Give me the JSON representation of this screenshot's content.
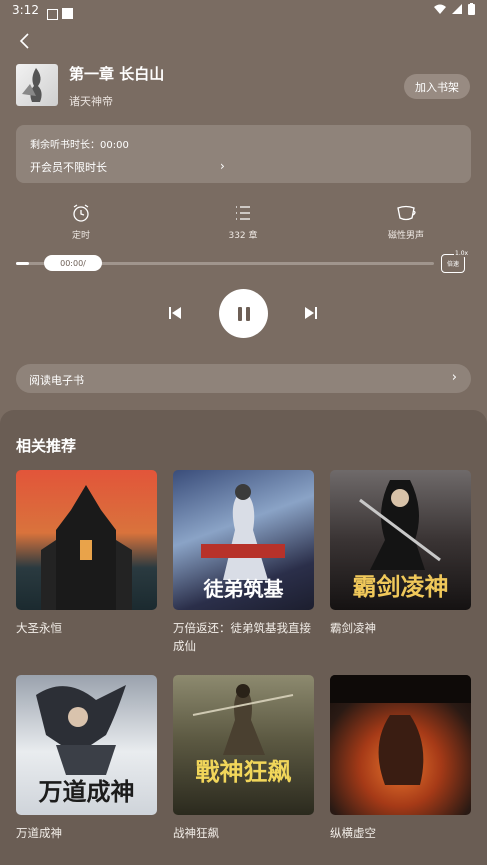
{
  "status_bar": {
    "time": "3:12"
  },
  "header": {
    "chapter_title": "第一章 长白山",
    "author": "诸天神帝",
    "add_shelf_label": "加入书架"
  },
  "vip_card": {
    "remaining_label": "剩余听书时长：00:00",
    "open_vip_label": "开会员不限时长"
  },
  "controls": {
    "timer_label": "定时",
    "chapters_label": "332 章",
    "voice_label": "磁性男声"
  },
  "progress": {
    "time_text": "00:00/",
    "fraction": 0.03,
    "speed_value": "1.0x",
    "speed_label": "倍速"
  },
  "ebook": {
    "label": "阅读电子书"
  },
  "recommend": {
    "title": "相关推荐",
    "books": [
      {
        "name": "大圣永恒",
        "cover_text": ""
      },
      {
        "name": "万倍返还：徒弟筑基我直接成仙",
        "cover_text": "徒弟筑基"
      },
      {
        "name": "霸剑凌神",
        "cover_text": "霸剑凌神"
      },
      {
        "name": "万道成神",
        "cover_text": "万道成神"
      },
      {
        "name": "战神狂飙",
        "cover_text": "戰神狂飙"
      },
      {
        "name": "纵横虚空",
        "cover_text": ""
      }
    ]
  },
  "colors": {
    "background": "#7a6c62",
    "panel": "#6a5d54",
    "card": "#8f837a"
  }
}
